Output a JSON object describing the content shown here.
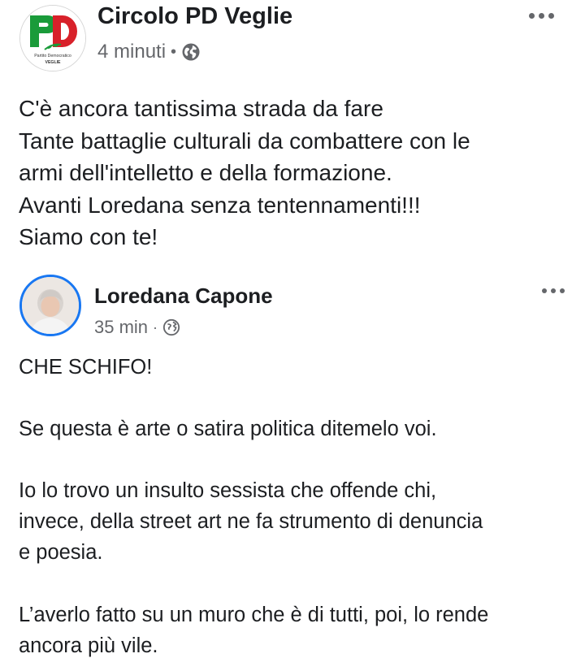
{
  "post": {
    "page_name": "Circolo PD Veglie",
    "time": "4 minuti",
    "separator": "•",
    "privacy_icon": "globe-icon",
    "more_icon": "more-options-icon",
    "logo": {
      "letters": "PD",
      "line1": "Partito Democratico",
      "line2": "VEGLIE",
      "colors": {
        "green": "#1a9b3a",
        "red": "#d8212a"
      }
    },
    "text_lines": [
      "C'è ancora tantissima strada da fare",
      "Tante battaglie culturali da combattere con le",
      "armi dell'intelletto e della formazione.",
      "Avanti Loredana senza tentennamenti!!!",
      "Siamo con te!"
    ]
  },
  "shared_post": {
    "author": "Loredana Capone",
    "time": "35 min",
    "separator": "·",
    "privacy_icon": "globe-icon",
    "more_icon": "more-options-icon",
    "avatar_ring_color": "#1877f2",
    "lines": [
      "CHE SCHIFO!",
      "Se questa è arte o satira politica ditemelo voi.",
      "Io lo trovo un insulto sessista che offende chi,",
      "invece, della street art ne fa strumento di denuncia",
      "e poesia.",
      "L’averlo fatto su un muro che è di tutti, poi, lo rende",
      "ancora più vile."
    ]
  }
}
